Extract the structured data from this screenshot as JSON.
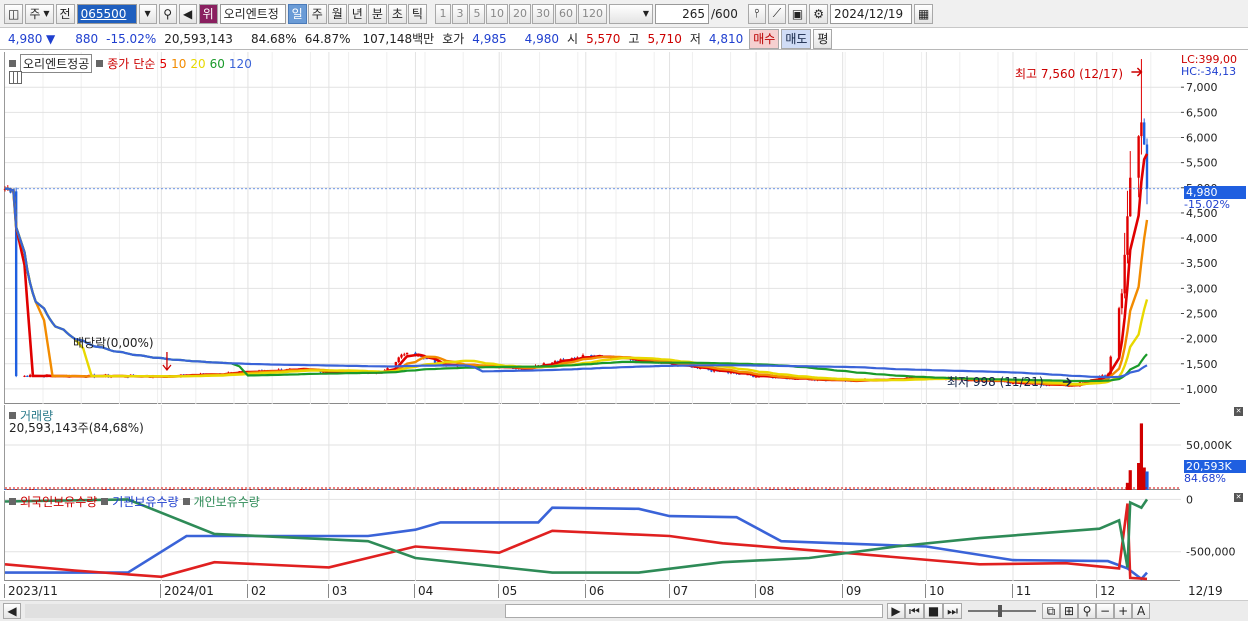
{
  "toolbar": {
    "type_label": "주",
    "prev_label": "전",
    "code": "065500",
    "stock_badge": "위",
    "stock_name": "오리엔트정",
    "periods": [
      "일",
      "주",
      "월",
      "년",
      "분",
      "초",
      "틱"
    ],
    "minutes": [
      "1",
      "3",
      "5",
      "10",
      "20",
      "30",
      "60",
      "120"
    ],
    "count": "265",
    "count_total": "/600",
    "date": "2024/12/19"
  },
  "quote": {
    "price": "4,980",
    "arrow": "▼",
    "change": "880",
    "change_pct": "-15.02%",
    "volume": "20,593,143",
    "vol_ratio": "84.68%",
    "turnover": "64.87%",
    "amount": "107,148백만",
    "hoga_label": "호가",
    "hoga_ask": "4,985",
    "hoga_bid": "4,980",
    "open_label": "시",
    "open": "5,570",
    "high_label": "고",
    "high": "5,710",
    "low_label": "저",
    "low": "4,810",
    "buy_label": "매수",
    "sell_label": "매도",
    "extra_label": "평"
  },
  "colors": {
    "up": "#e00000",
    "down": "#1f5fe0",
    "ma5": "#e00000",
    "ma10": "#f28b00",
    "ma20": "#e8d800",
    "ma60": "#1a9a2a",
    "ma120": "#3a63d8",
    "foreign": "#e02020",
    "inst": "#3a63d8",
    "indiv": "#2e8b57"
  },
  "chart_data": [
    {
      "type": "candlestick",
      "legend": {
        "name": "오리엔트정공",
        "price_label": "종가",
        "ma_type": "단순",
        "ma_periods": [
          "5",
          "10",
          "20",
          "60",
          "120"
        ]
      },
      "ylim": [
        700,
        7700
      ],
      "yticks": [
        "1,000",
        "1,500",
        "2,000",
        "2,500",
        "3,000",
        "3,500",
        "4,000",
        "4,500",
        "5,000",
        "5,500",
        "6,000",
        "6,500",
        "7,000"
      ],
      "ytick_values": [
        1000,
        1500,
        2000,
        2500,
        3000,
        3500,
        4000,
        4500,
        5000,
        5500,
        6000,
        6500,
        7000
      ],
      "right_labels": {
        "lc": "LC:399,00",
        "hc": "HC:-34,13",
        "price": "4,980",
        "pct": "-15.02%"
      },
      "annotations": {
        "high": "최고 7,560 (12/17)",
        "low": "최저 998 (11/21)",
        "dividend": "배당락(0,00%)"
      },
      "close_series": [
        {
          "date": "2023-11-10",
          "close": 1260
        },
        {
          "date": "2024-01-03",
          "close": 1250
        },
        {
          "date": "2024-02-15",
          "close": 1380
        },
        {
          "date": "2024-03-20",
          "close": 1320
        },
        {
          "date": "2024-03-29",
          "close": 1750
        },
        {
          "date": "2024-04-08",
          "close": 1500
        },
        {
          "date": "2024-05-10",
          "close": 1420
        },
        {
          "date": "2024-06-03",
          "close": 1680
        },
        {
          "date": "2024-07-01",
          "close": 1480
        },
        {
          "date": "2024-08-01",
          "close": 1250
        },
        {
          "date": "2024-09-02",
          "close": 1160
        },
        {
          "date": "2024-10-01",
          "close": 1230
        },
        {
          "date": "2024-11-21",
          "close": 1060
        },
        {
          "date": "2024-12-05",
          "close": 1300
        },
        {
          "date": "2024-12-10",
          "close": 2900
        },
        {
          "date": "2024-12-13",
          "close": 5200
        },
        {
          "date": "2024-12-17",
          "close": 6300
        },
        {
          "date": "2024-12-18",
          "close": 5860
        },
        {
          "date": "2024-12-19",
          "close": 4980
        }
      ]
    },
    {
      "type": "bar",
      "title": "거래량",
      "current": "20,593,143주(84,68%)",
      "yticks": [
        "50,000K"
      ],
      "ytick_values": [
        50000
      ],
      "right_labels": {
        "value": "20,593K",
        "pct": "84.68%"
      },
      "values_k": [
        {
          "date": "2024-12-12",
          "v": 8000
        },
        {
          "date": "2024-12-13",
          "v": 22000
        },
        {
          "date": "2024-12-16",
          "v": 30000
        },
        {
          "date": "2024-12-17",
          "v": 74000
        },
        {
          "date": "2024-12-18",
          "v": 25000
        },
        {
          "date": "2024-12-19",
          "v": 20593
        }
      ]
    },
    {
      "type": "line",
      "legend": [
        "외국인보유수량",
        "기관보유수량",
        "개인보유수량"
      ],
      "yticks": [
        "0",
        "-500,000"
      ],
      "ytick_values": [
        0,
        -500000
      ],
      "ylim": [
        -780000,
        80000
      ]
    }
  ],
  "xaxis": {
    "labels": [
      "2023/11",
      "2024/01",
      "02",
      "03",
      "04",
      "05",
      "06",
      "07",
      "08",
      "09",
      "10",
      "11",
      "12",
      "12/19"
    ]
  }
}
